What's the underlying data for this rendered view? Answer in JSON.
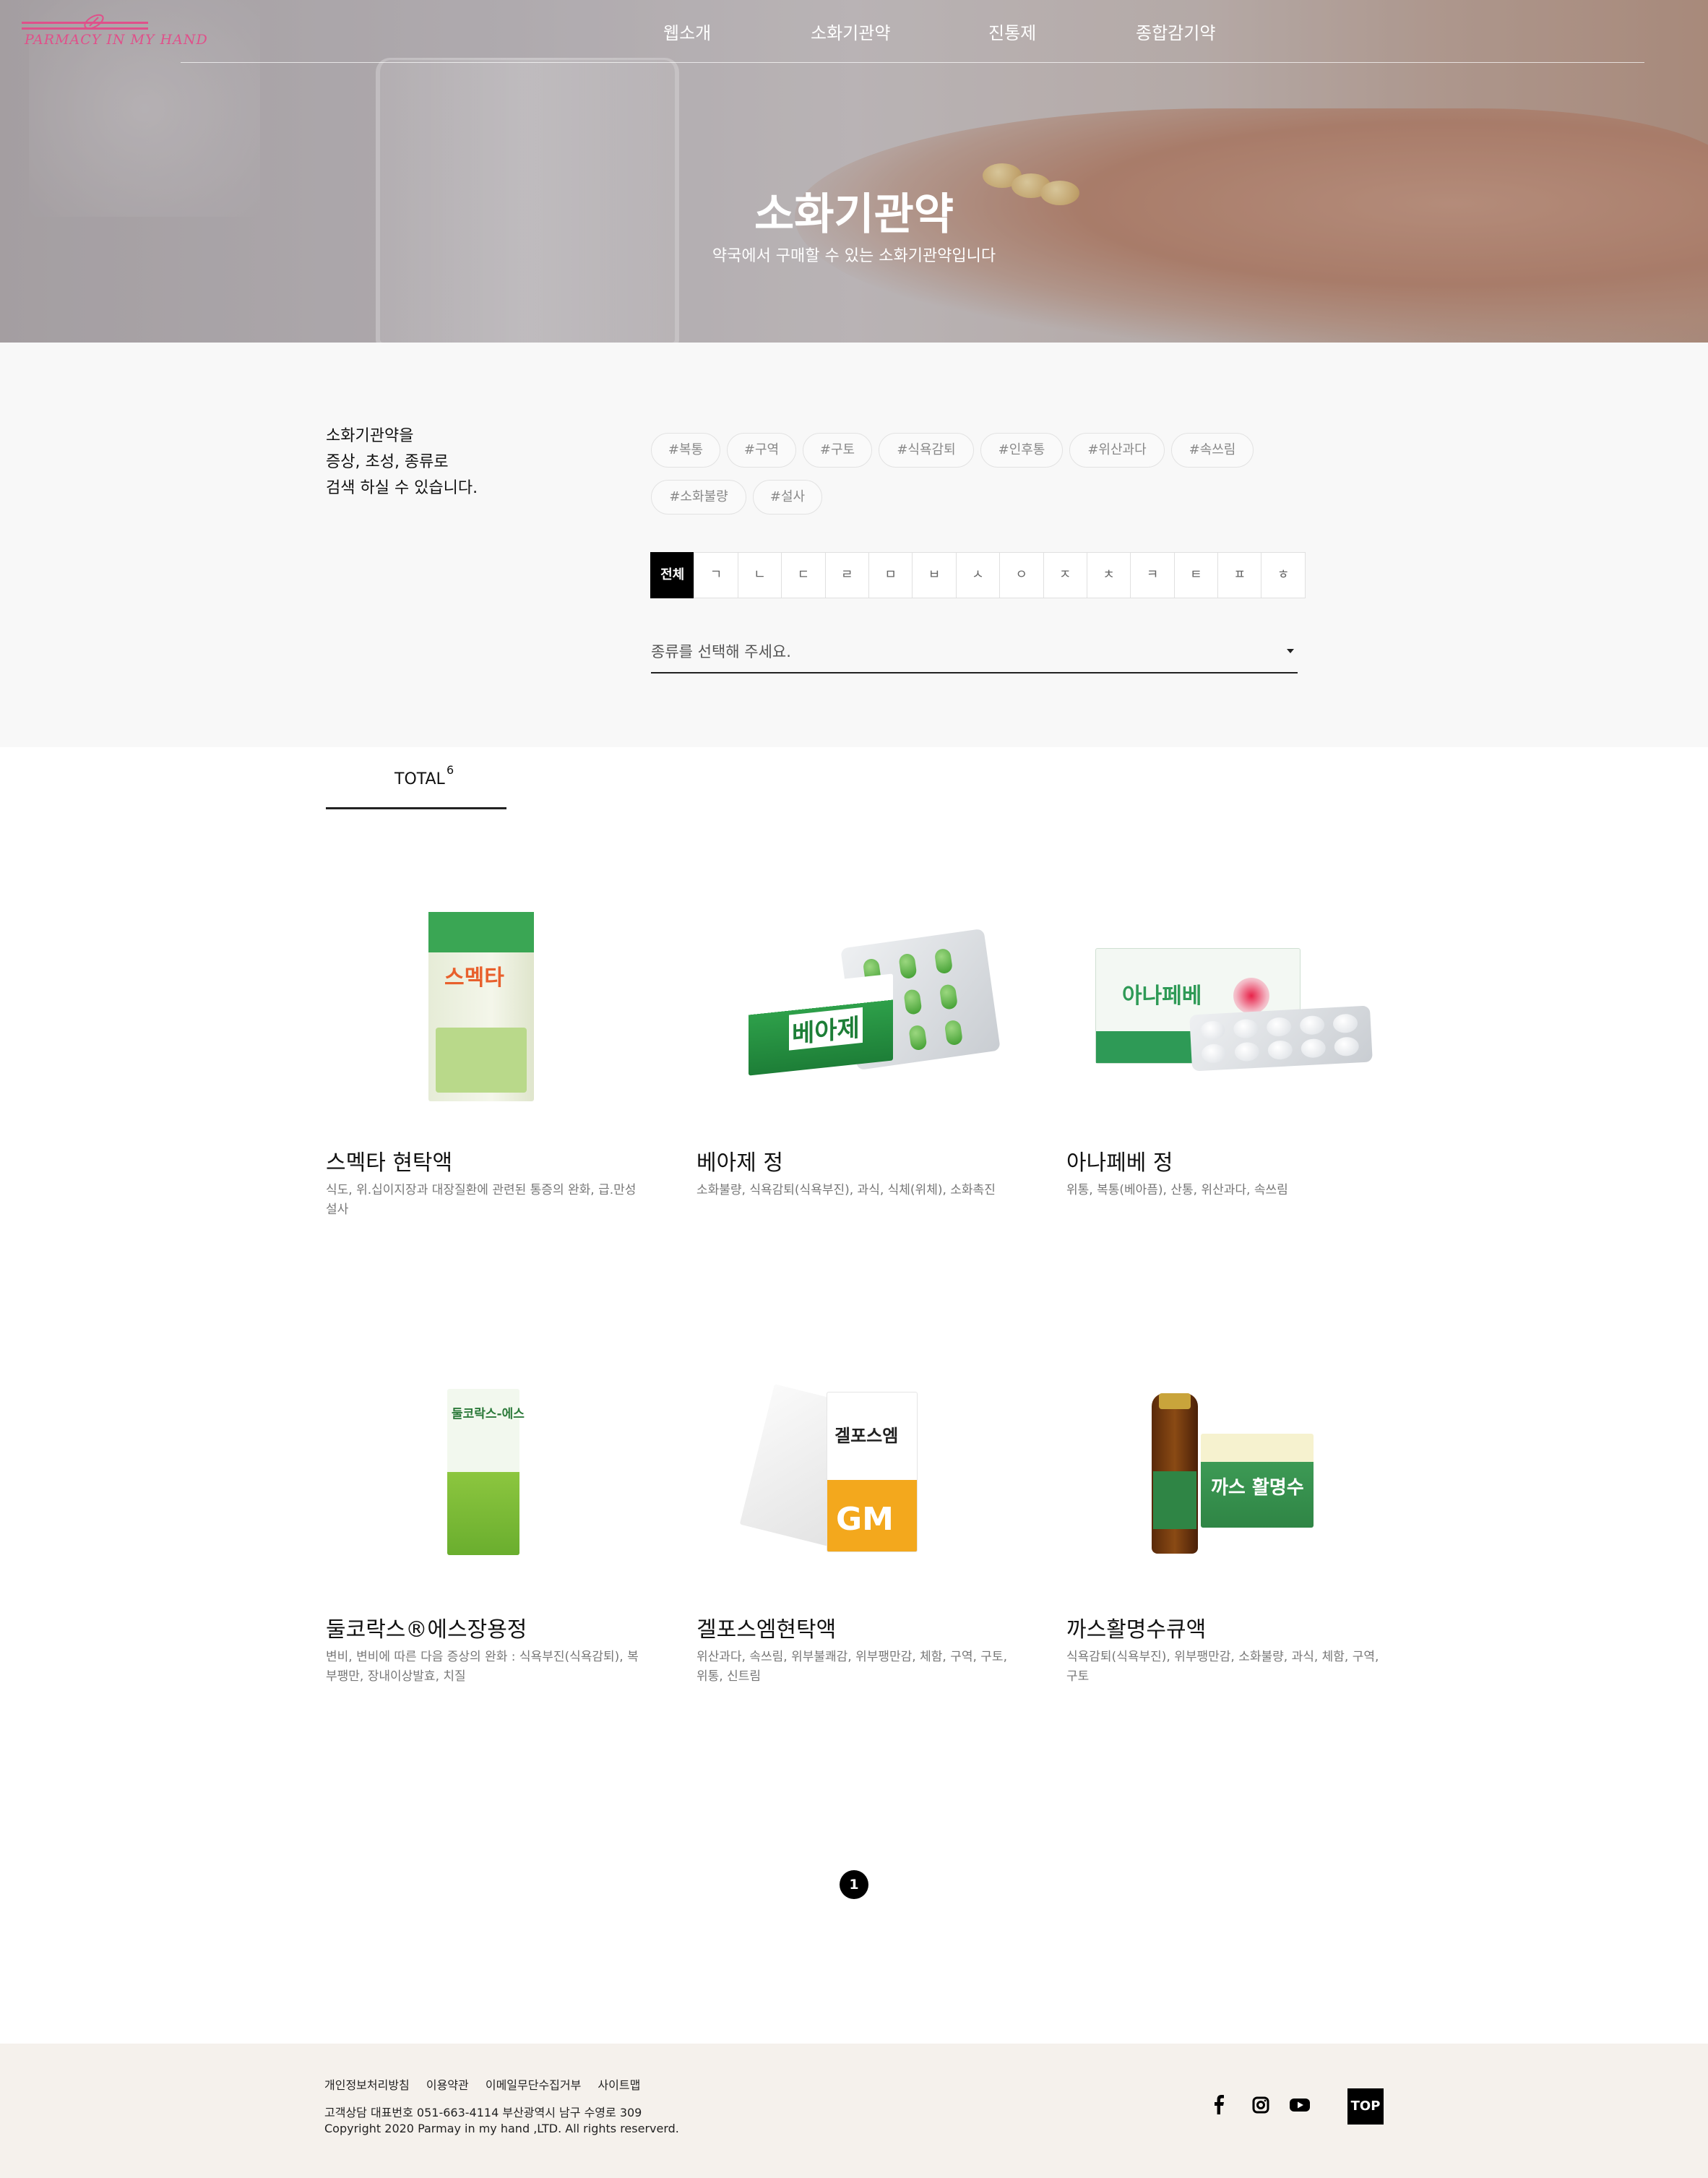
{
  "header": {
    "logo_text": "PARMACY IN MY HAND",
    "nav": [
      "웹소개",
      "소화기관약",
      "진통제",
      "종합감기약"
    ]
  },
  "hero": {
    "title": "소화기관약",
    "subtitle": "약국에서 구매할 수 있는 소화기관약입니다"
  },
  "search": {
    "description": [
      "소화기관약을",
      "증상, 초성, 종류로",
      "검색 하실 수 있습니다."
    ],
    "tags": [
      "#복통",
      "#구역",
      "#구토",
      "#식욕감퇴",
      "#인후통",
      "#위산과다",
      "#속쓰림",
      "#소화불량",
      "#설사"
    ],
    "consonants": [
      "전체",
      "ㄱ",
      "ㄴ",
      "ㄷ",
      "ㄹ",
      "ㅁ",
      "ㅂ",
      "ㅅ",
      "ㅇ",
      "ㅈ",
      "ㅊ",
      "ㅋ",
      "ㅌ",
      "ㅍ",
      "ㅎ"
    ],
    "select_placeholder": "종류를 선택해 주세요."
  },
  "total": {
    "label": "TOTAL",
    "count": "6"
  },
  "products": [
    {
      "name": "스멕타 현탁액",
      "symptoms": "식도, 위.십이지장과 대장질환에 관련된 통증의 완화, 급.만성 설사",
      "pkg_text": "스멕타"
    },
    {
      "name": "베아제 정",
      "symptoms": "소화불량, 식욕감퇴(식욕부진), 과식, 식체(위체), 소화촉진",
      "pkg_text": "베아제"
    },
    {
      "name": "아나페베 정",
      "symptoms": "위통, 복통(베아픔), 산통, 위산과다, 속쓰림",
      "pkg_text": "아나페베"
    },
    {
      "name": "둘코락스®에스장용정",
      "symptoms": "변비, 변비에 따른 다음 증상의 완화 : 식욕부진(식욕감퇴), 복부팽만, 장내이상발효, 치질",
      "pkg_text": "둘코락스-에스"
    },
    {
      "name": "겔포스엠현탁액",
      "symptoms": "위산과다, 속쓰림, 위부불쾌감, 위부팽만감, 체함, 구역, 구토, 위통, 신트림",
      "pkg_text": "겔포스엠"
    },
    {
      "name": "까스활명수큐액",
      "symptoms": "식욕감퇴(식욕부진), 위부팽만감, 소화불량, 과식, 체함, 구역, 구토",
      "pkg_text": "까스 활명수"
    }
  ],
  "pagination": {
    "current": "1"
  },
  "footer": {
    "links": [
      "개인정보처리방침",
      "이용약관",
      "이메일무단수집거부",
      "사이트맵"
    ],
    "info": "고객상담 대표번호 051-663-4114 부산광역시 남구 수영로 309",
    "copyright": "Copyright 2020 Parmay in my hand ,LTD. All rights reserverd.",
    "social": [
      "facebook-icon",
      "instagram-icon",
      "youtube-icon"
    ],
    "top_label": "TOP"
  }
}
